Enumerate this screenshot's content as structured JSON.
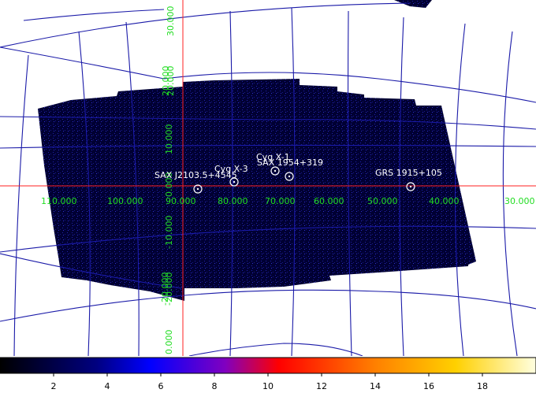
{
  "grid": {
    "lon_labels": [
      "110.000",
      "100.000",
      "90.000",
      "80.000",
      "70.000",
      "60.000",
      "50.000",
      "40.000",
      "30.000"
    ],
    "lat_labels": [
      "30.000",
      "20.000",
      "10.000",
      "0.000",
      "-10.000",
      "-20.000"
    ],
    "lat_axis_labels_upper": [
      "30.000",
      "20.000"
    ],
    "lat_axis_labels_lower": [
      "-20.000",
      "0.000"
    ],
    "line_color": "#1a1aa8",
    "axis_color": "#ff2020",
    "label_color": "#22dd22"
  },
  "sources": [
    {
      "name": "SAX J2103.5+4545"
    },
    {
      "name": "Cyg X-3"
    },
    {
      "name": "Cyg X-1"
    },
    {
      "name": "SAX 1954+319"
    },
    {
      "name": "GRS 1915+105"
    }
  ],
  "colorbar": {
    "ticks": [
      "2",
      "4",
      "6",
      "8",
      "10",
      "12",
      "14",
      "16",
      "18"
    ],
    "min": 0,
    "max": 20,
    "colormap": "heat"
  }
}
